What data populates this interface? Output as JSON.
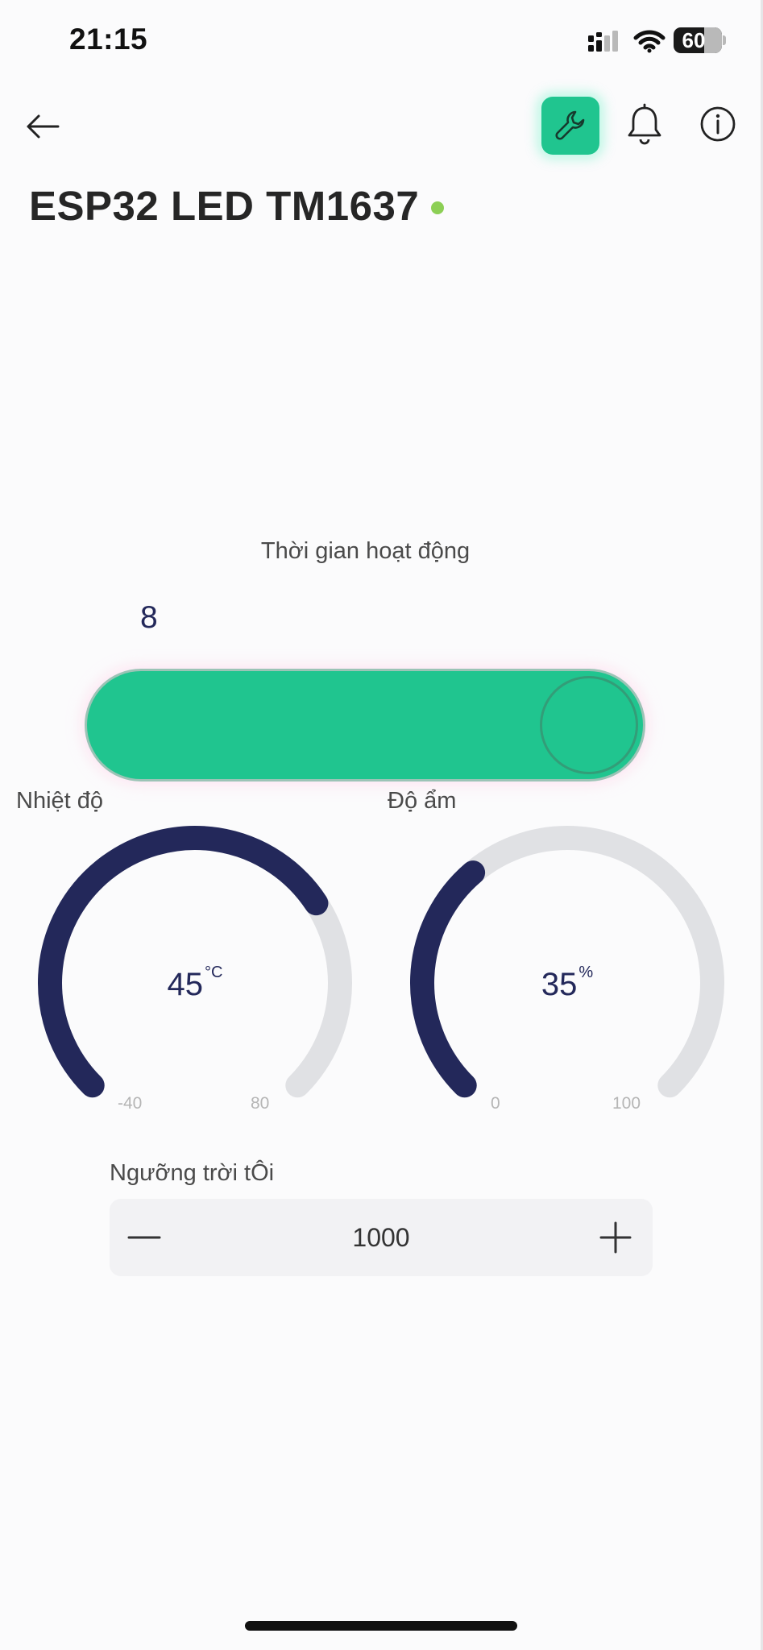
{
  "status_bar": {
    "time": "21:15",
    "battery": "60"
  },
  "nav": {
    "back_icon": "arrow-left-icon",
    "settings_icon": "wrench-icon",
    "notifications_icon": "bell-icon",
    "info_icon": "info-icon"
  },
  "device": {
    "name": "ESP32 LED TM1637",
    "status_color": "#8ccf55"
  },
  "slider": {
    "title": "Thời gian hoạt độ̣ng",
    "value": "8",
    "fill_fraction": 1.0,
    "color": "#20c58f"
  },
  "gauges": [
    {
      "label": "Nhiệt độ̣",
      "value": "45",
      "unit": "°C",
      "min": "-40",
      "max": "80",
      "fraction": 0.71
    },
    {
      "label": "Độ̣ ẩm",
      "value": "35",
      "unit": "%",
      "min": "0",
      "max": "100",
      "fraction": 0.35
    }
  ],
  "stepper": {
    "label": "Ngưỡng trời tÔi",
    "value": "1000",
    "minus_icon": "minus-icon",
    "plus_icon": "plus-icon"
  },
  "colors": {
    "accent": "#20c58f",
    "gauge_fill": "#23285a",
    "gauge_track": "#e0e1e4"
  }
}
